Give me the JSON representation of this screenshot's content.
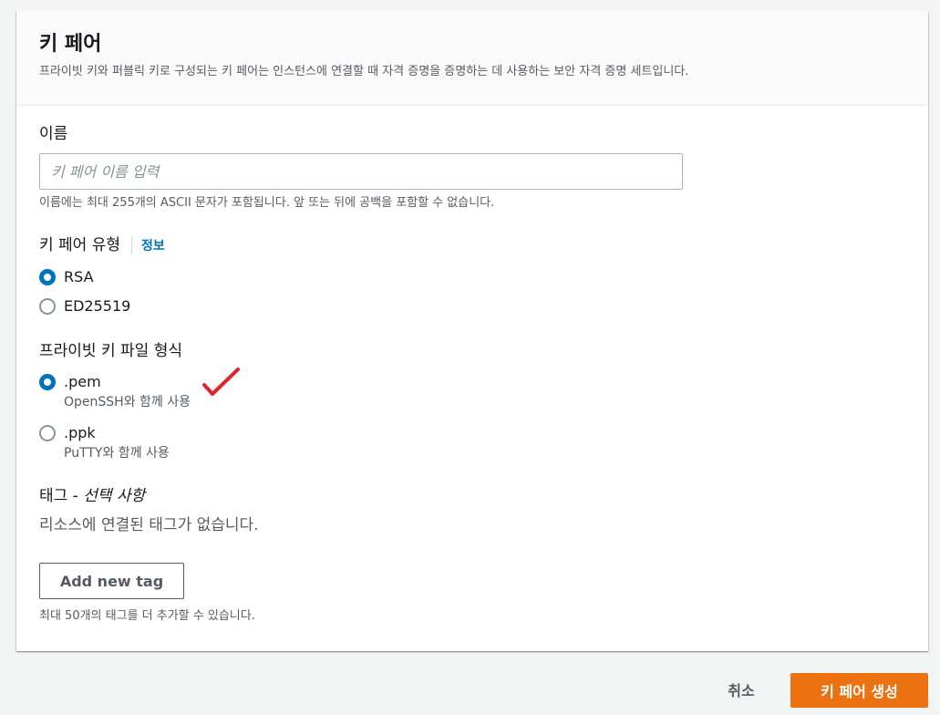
{
  "panel": {
    "title": "키 페어",
    "description": "프라이빗 키와 퍼블릭 키로 구성되는 키 페어는 인스턴스에 연결할 때 자격 증명을 증명하는 데 사용하는 보안 자격 증명 세트입니다."
  },
  "name_field": {
    "label": "이름",
    "placeholder": "키 페어 이름 입력",
    "value": "",
    "hint": "이름에는 최대 255개의 ASCII 문자가 포함됩니다. 앞 또는 뒤에 공백을 포함할 수 없습니다."
  },
  "key_type": {
    "label": "키 페어 유형",
    "info_link": "정보",
    "options": [
      {
        "label": "RSA",
        "selected": true
      },
      {
        "label": "ED25519",
        "selected": false
      }
    ]
  },
  "file_format": {
    "label": "프라이빗 키 파일 형식",
    "options": [
      {
        "label": ".pem",
        "description": "OpenSSH와 함께 사용",
        "selected": true
      },
      {
        "label": ".ppk",
        "description": "PuTTY와 함께 사용",
        "selected": false
      }
    ]
  },
  "tags": {
    "label": "태그 -",
    "label_optional": "선택 사항",
    "empty_text": "리소스에 연결된 태그가 없습니다.",
    "add_button": "Add new tag",
    "hint": "최대 50개의 태그를 더 추가할 수 있습니다."
  },
  "footer": {
    "cancel_label": "취소",
    "create_label": "키 페어 생성"
  },
  "annotation": {
    "icon": "red-checkmark-icon",
    "color": "#e0242b"
  },
  "colors": {
    "accent": "#0073bb",
    "primary_button": "#ec7211"
  }
}
